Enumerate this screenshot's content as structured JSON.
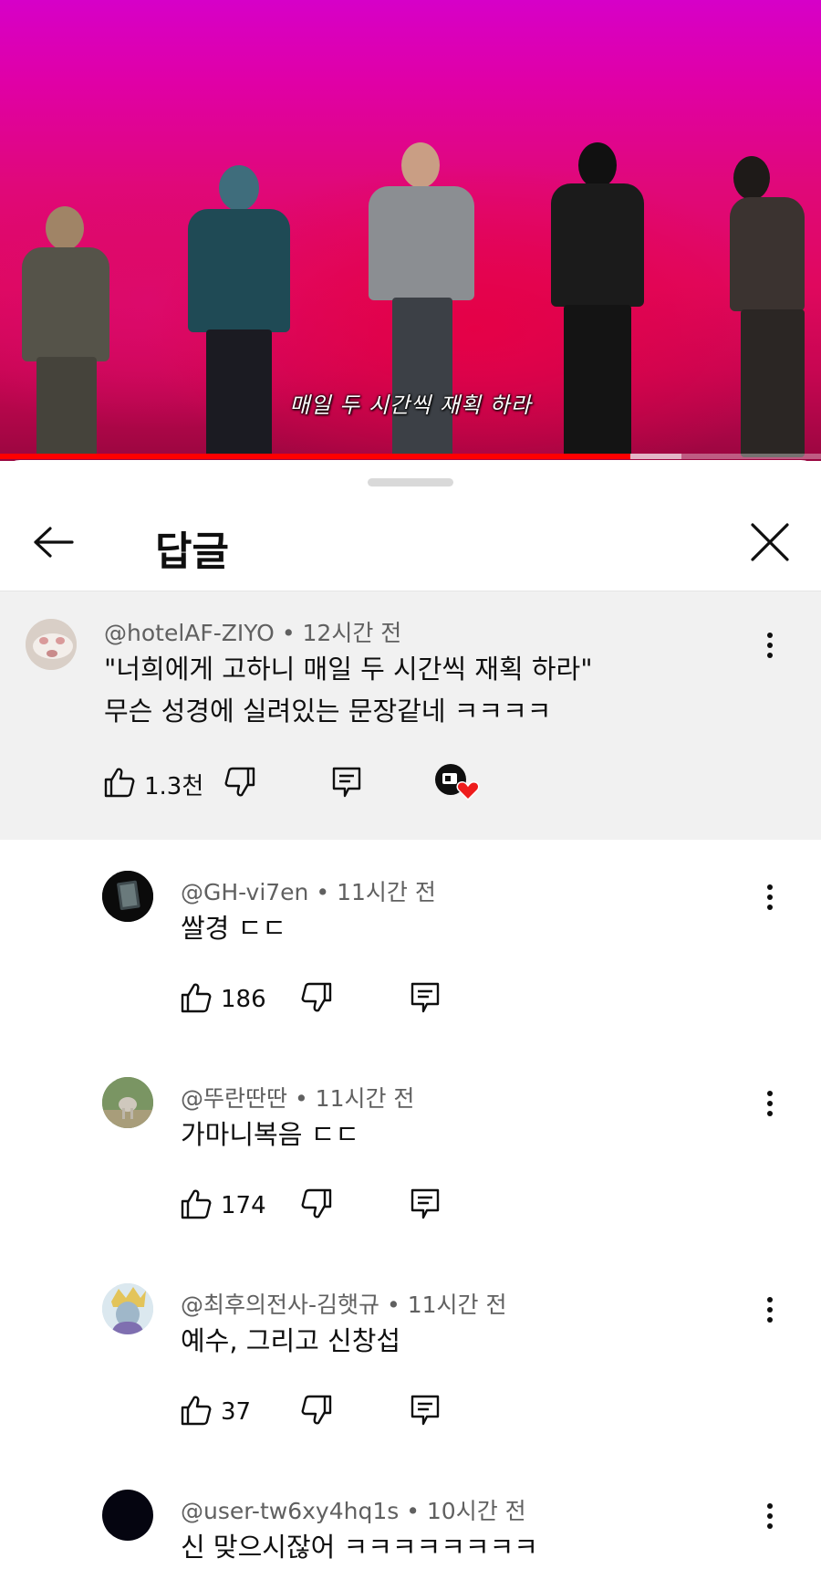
{
  "video": {
    "subtitle": "매일 두 시간씩 재획 하라",
    "progress_fraction": 0.768,
    "buffer_fraction": 0.83
  },
  "header": {
    "title": "답글"
  },
  "parent_comment": {
    "author": "@hotelAF-ZIYO",
    "time": "12시간 전",
    "lines": [
      "\"너희에게 고하니 매일 두 시간씩 재획 하라\"",
      "무슨 성경에 실려있는 문장같네 ㅋㅋㅋㅋ"
    ],
    "likes": "1.3천",
    "creator_heart": true
  },
  "replies": [
    {
      "author": "@GH-vi7en",
      "time": "11시간 전",
      "text": "쌀경 ㄷㄷ",
      "likes": "186"
    },
    {
      "author": "@뚜란딴딴",
      "time": "11시간 전",
      "text": "가마니복음 ㄷㄷ",
      "likes": "174"
    },
    {
      "author": "@최후의전사-김햇규",
      "time": "11시간 전",
      "text": "예수, 그리고 신창섭",
      "likes": "37"
    },
    {
      "author": "@user-tw6xy4hq1s",
      "time": "10시간 전",
      "text": "신 맞으시잖어 ㅋㅋㅋㅋㅋㅋㅋㅋ",
      "likes": ""
    }
  ],
  "meta_separator": "•",
  "colors": {
    "accent_red": "#ff0000",
    "parent_bg": "#f1f1f1",
    "meta_text": "#606060"
  },
  "icons": {
    "back": "arrow-left-icon",
    "close": "close-icon",
    "like": "thumb-up-icon",
    "dislike": "thumb-down-icon",
    "reply": "comment-reply-icon",
    "more": "more-vert-icon",
    "creator_heart": "creator-heart-icon"
  }
}
